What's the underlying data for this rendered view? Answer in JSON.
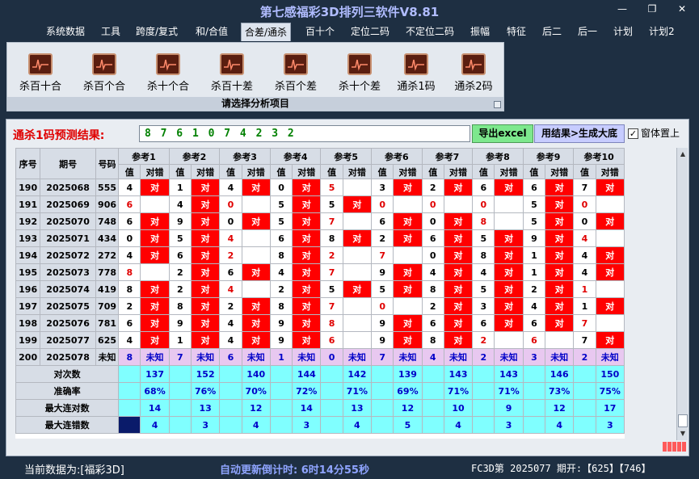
{
  "window": {
    "title": "第七感福彩3D排列三软件V8.81",
    "min_glyph": "—",
    "max_glyph": "❐",
    "close_glyph": "✕"
  },
  "menu": [
    {
      "label": "系统数据"
    },
    {
      "label": "工具"
    },
    {
      "label": "跨度/复式"
    },
    {
      "label": "和/合值"
    },
    {
      "label": "合差/通杀"
    },
    {
      "label": "百十个"
    },
    {
      "label": "定位二码"
    },
    {
      "label": "不定位二码"
    },
    {
      "label": "振幅"
    },
    {
      "label": "特征"
    },
    {
      "label": "后二"
    },
    {
      "label": "后一"
    },
    {
      "label": "计划"
    },
    {
      "label": "计划2"
    }
  ],
  "ribbon": {
    "buttons": [
      {
        "label": "杀百十合",
        "icon": "chart-icon"
      },
      {
        "label": "杀百个合",
        "icon": "chart-icon"
      },
      {
        "label": "杀十个合",
        "icon": "chart-icon"
      },
      {
        "label": "杀百十差",
        "icon": "chart-icon"
      },
      {
        "label": "杀百个差",
        "icon": "chart-icon"
      },
      {
        "label": "杀十个差",
        "icon": "chart-icon"
      },
      {
        "label": "通杀1码",
        "icon": "chart-icon"
      },
      {
        "label": "通杀2码",
        "icon": "chart-icon"
      }
    ],
    "caption": "请选择分析项目"
  },
  "prediction": {
    "label": "通杀1码预测结果:",
    "value": "8 7 6 1 0 7 4 2 3 2",
    "export_button": "导出excel",
    "result_button": "用结果>生成大底",
    "top_checkbox_label": "窗体置上",
    "top_checked": true
  },
  "grid": {
    "headers": {
      "seq": "序号",
      "period": "期号",
      "number": "号码",
      "groups": [
        "参考1",
        "参考2",
        "参考3",
        "参考4",
        "参考5",
        "参考6",
        "参考7",
        "参考8",
        "参考9",
        "参考10"
      ],
      "val": "值",
      "check": "对错"
    },
    "hit_mark": "对",
    "rows": [
      {
        "seq": "190",
        "period": "2025068",
        "number": "555",
        "vals": [
          "4",
          "1",
          "4",
          "0",
          "5",
          "3",
          "2",
          "6",
          "6",
          "7"
        ],
        "hits": [
          1,
          1,
          1,
          1,
          0,
          1,
          1,
          1,
          1,
          1
        ],
        "miss_red": [
          0,
          0,
          0,
          0,
          1,
          0,
          0,
          0,
          0,
          0
        ]
      },
      {
        "seq": "191",
        "period": "2025069",
        "number": "906",
        "vals": [
          "6",
          "4",
          "0",
          "5",
          "5",
          "0",
          "0",
          "0",
          "5",
          "0"
        ],
        "hits": [
          0,
          1,
          0,
          1,
          1,
          0,
          0,
          0,
          1,
          0
        ],
        "miss_red": [
          1,
          0,
          1,
          0,
          0,
          1,
          1,
          1,
          0,
          1
        ]
      },
      {
        "seq": "192",
        "period": "2025070",
        "number": "748",
        "vals": [
          "6",
          "9",
          "0",
          "5",
          "7",
          "6",
          "0",
          "8",
          "5",
          "0"
        ],
        "hits": [
          1,
          1,
          1,
          1,
          0,
          1,
          1,
          0,
          1,
          1
        ],
        "miss_red": [
          0,
          0,
          0,
          0,
          1,
          0,
          0,
          1,
          0,
          0
        ]
      },
      {
        "seq": "193",
        "period": "2025071",
        "number": "434",
        "vals": [
          "0",
          "5",
          "4",
          "6",
          "8",
          "2",
          "6",
          "5",
          "9",
          "4"
        ],
        "hits": [
          1,
          1,
          0,
          1,
          1,
          1,
          1,
          1,
          1,
          0
        ],
        "miss_red": [
          0,
          0,
          1,
          0,
          0,
          0,
          0,
          0,
          0,
          1
        ]
      },
      {
        "seq": "194",
        "period": "2025072",
        "number": "272",
        "vals": [
          "4",
          "6",
          "2",
          "8",
          "2",
          "7",
          "0",
          "8",
          "1",
          "4"
        ],
        "hits": [
          1,
          1,
          0,
          1,
          0,
          0,
          1,
          1,
          1,
          1
        ],
        "miss_red": [
          0,
          0,
          1,
          0,
          1,
          1,
          0,
          0,
          0,
          0
        ]
      },
      {
        "seq": "195",
        "period": "2025073",
        "number": "778",
        "vals": [
          "8",
          "2",
          "6",
          "4",
          "7",
          "9",
          "4",
          "4",
          "1",
          "4"
        ],
        "hits": [
          0,
          1,
          1,
          1,
          0,
          1,
          1,
          1,
          1,
          1
        ],
        "miss_red": [
          1,
          0,
          0,
          0,
          1,
          0,
          0,
          0,
          0,
          0
        ]
      },
      {
        "seq": "196",
        "period": "2025074",
        "number": "419",
        "vals": [
          "8",
          "2",
          "4",
          "2",
          "5",
          "5",
          "8",
          "5",
          "2",
          "1"
        ],
        "hits": [
          1,
          1,
          0,
          1,
          1,
          1,
          1,
          1,
          1,
          0
        ],
        "miss_red": [
          0,
          0,
          1,
          0,
          0,
          0,
          0,
          0,
          0,
          1
        ]
      },
      {
        "seq": "197",
        "period": "2025075",
        "number": "709",
        "vals": [
          "2",
          "8",
          "2",
          "8",
          "7",
          "0",
          "2",
          "3",
          "4",
          "1"
        ],
        "hits": [
          1,
          1,
          1,
          1,
          0,
          0,
          1,
          1,
          1,
          1
        ],
        "miss_red": [
          0,
          0,
          0,
          0,
          1,
          1,
          0,
          0,
          0,
          0
        ]
      },
      {
        "seq": "198",
        "period": "2025076",
        "number": "781",
        "vals": [
          "6",
          "9",
          "4",
          "9",
          "8",
          "9",
          "6",
          "6",
          "6",
          "7"
        ],
        "hits": [
          1,
          1,
          1,
          1,
          0,
          1,
          1,
          1,
          1,
          0
        ],
        "miss_red": [
          0,
          0,
          0,
          0,
          1,
          0,
          0,
          0,
          0,
          1
        ]
      },
      {
        "seq": "199",
        "period": "2025077",
        "number": "625",
        "vals": [
          "4",
          "1",
          "4",
          "9",
          "6",
          "9",
          "8",
          "2",
          "6",
          "7"
        ],
        "hits": [
          1,
          1,
          1,
          1,
          0,
          1,
          1,
          0,
          0,
          1
        ],
        "miss_red": [
          0,
          0,
          0,
          0,
          1,
          0,
          0,
          1,
          1,
          0
        ]
      }
    ],
    "predict_row": {
      "seq": "200",
      "period": "2025078",
      "number": "未知",
      "vals": [
        "8",
        "7",
        "6",
        "1",
        "0",
        "7",
        "4",
        "2",
        "3",
        "2"
      ],
      "unknown": "未知"
    },
    "stats": [
      {
        "label": "对次数",
        "values": [
          "137",
          "152",
          "140",
          "144",
          "142",
          "139",
          "143",
          "143",
          "146",
          "150"
        ]
      },
      {
        "label": "准确率",
        "values": [
          "68%",
          "76%",
          "70%",
          "72%",
          "71%",
          "69%",
          "71%",
          "71%",
          "73%",
          "75%"
        ]
      },
      {
        "label": "最大连对数",
        "values": [
          "14",
          "13",
          "12",
          "14",
          "13",
          "12",
          "10",
          "9",
          "12",
          "17"
        ]
      },
      {
        "label": "最大连错数",
        "values": [
          "4",
          "3",
          "4",
          "3",
          "4",
          "5",
          "4",
          "3",
          "4",
          "3"
        ]
      }
    ]
  },
  "status": {
    "current_label": "当前数据为:[福彩3D]",
    "countdown": "自动更新倒计时: 6时14分55秒",
    "draw_info": "FC3D第 2025077 期开:【625】【746】"
  },
  "colors": {
    "hit_bg": "#ff0000",
    "stat_bg": "#80ffff",
    "predict_bg": "#e8c8f0",
    "export_btn": "#7de88d",
    "result_btn": "#c7ccff"
  }
}
